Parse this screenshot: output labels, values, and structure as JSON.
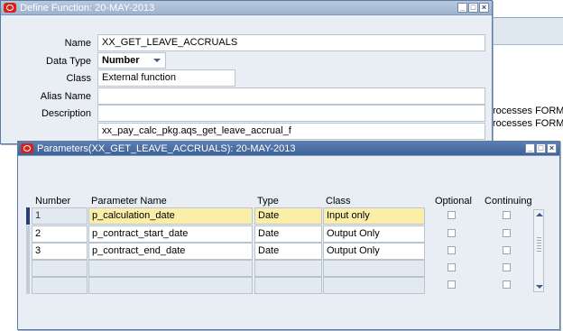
{
  "background": {
    "processes_line_1": "rocesses FORM",
    "processes_line_2": "rocesses FORM"
  },
  "define_window": {
    "title": "Define Function: 20-MAY-2013",
    "fields": {
      "name_label": "Name",
      "name_value": "XX_GET_LEAVE_ACCRUALS",
      "data_type_label": "Data Type",
      "data_type_value": "Number",
      "class_label": "Class",
      "class_value": "External function",
      "alias_label": "Alias Name",
      "alias_value": "",
      "description_label": "Description",
      "description_value": "",
      "definition_value": "xx_pay_calc_pkg.aqs_get_leave_accrual_f"
    }
  },
  "params_window": {
    "title": "Parameters(XX_GET_LEAVE_ACCRUALS): 20-MAY-2013",
    "columns": {
      "number": "Number",
      "name": "Parameter Name",
      "type": "Type",
      "class": "Class",
      "optional": "Optional",
      "continuing": "Continuing"
    },
    "rows": [
      {
        "number": "1",
        "name": "p_calculation_date",
        "type": "Date",
        "class": "Input only"
      },
      {
        "number": "2",
        "name": "p_contract_start_date",
        "type": "Date",
        "class": "Output Only"
      },
      {
        "number": "3",
        "name": "p_contract_end_date",
        "type": "Date",
        "class": "Output Only"
      },
      {
        "number": "",
        "name": "",
        "type": "",
        "class": ""
      },
      {
        "number": "",
        "name": "",
        "type": "",
        "class": ""
      }
    ]
  },
  "colors": {
    "accent_titlebar": "#3d6299",
    "selected_row": "#fbeea9",
    "oracle_red": "#d3231e"
  }
}
